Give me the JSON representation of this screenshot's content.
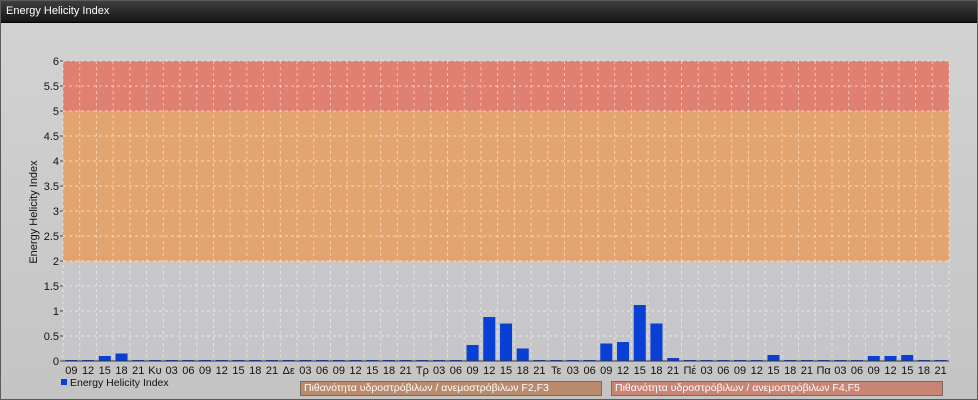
{
  "window": {
    "title": "Energy Helicity Index"
  },
  "colors": {
    "band_high": "#e07b6a",
    "band_mid": "#e3a26c",
    "band_low": "#c7c7cb",
    "bar": "#0a3fd6",
    "legend_f23_bg": "#b98a6b",
    "legend_f45_bg": "#c98474"
  },
  "chart_data": {
    "type": "bar",
    "ylabel": "Energy Helicity Index",
    "ylim": [
      0,
      6
    ],
    "yticks": [
      "0",
      "0.5",
      "1",
      "1.5",
      "2",
      "2.5",
      "3",
      "3.5",
      "4",
      "4.5",
      "5",
      "5.5",
      "6"
    ],
    "categories": [
      "09",
      "12",
      "15",
      "18",
      "21",
      "Κυ",
      "03",
      "06",
      "09",
      "12",
      "15",
      "18",
      "21",
      "Δε",
      "03",
      "06",
      "09",
      "12",
      "15",
      "18",
      "21",
      "Τρ",
      "03",
      "06",
      "09",
      "12",
      "15",
      "18",
      "21",
      "Τε",
      "03",
      "06",
      "09",
      "12",
      "15",
      "18",
      "21",
      "Πέ",
      "03",
      "06",
      "09",
      "12",
      "15",
      "18",
      "21",
      "Πα",
      "03",
      "06",
      "09",
      "12",
      "15",
      "18",
      "21"
    ],
    "series": [
      {
        "name": "Energy Helicity Index",
        "values": [
          0.02,
          0.02,
          0.1,
          0.15,
          0.02,
          0.02,
          0.02,
          0.02,
          0.02,
          0.02,
          0.02,
          0.02,
          0.02,
          0.02,
          0.02,
          0.02,
          0.02,
          0.02,
          0.02,
          0.02,
          0.02,
          0.02,
          0.02,
          0.02,
          0.32,
          0.88,
          0.75,
          0.25,
          0.02,
          0.02,
          0.02,
          0.02,
          0.35,
          0.38,
          1.12,
          0.75,
          0.06,
          0.02,
          0.02,
          0.02,
          0.02,
          0.02,
          0.12,
          0.02,
          0.02,
          0.02,
          0.02,
          0.02,
          0.1,
          0.1,
          0.12,
          0.02,
          0.02
        ]
      }
    ],
    "bands": [
      {
        "from": 5,
        "to": 6,
        "label": ""
      },
      {
        "from": 2,
        "to": 5,
        "label": "Πιθανότητα υδροστρόβιλων / ανεμοστρόβιλων F2,F3"
      },
      {
        "from": 0,
        "to": 2,
        "label": ""
      }
    ],
    "grid": true,
    "legend": [
      "Energy Helicity Index",
      "Πιθανότητα υδροστρόβιλων / ανεμοστρόβιλων F2,F3",
      "Πιθανότητα υδροστρόβιλων / ανεμοστρόβιλων F4,F5"
    ],
    "legend_position": "bottom"
  }
}
